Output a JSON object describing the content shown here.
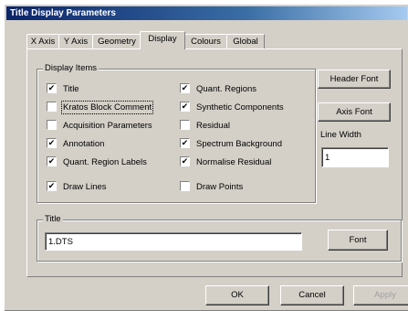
{
  "window": {
    "title": "Title Display Parameters"
  },
  "tabs": [
    {
      "label": "X Axis"
    },
    {
      "label": "Y Axis"
    },
    {
      "label": "Geometry"
    },
    {
      "label": "Display"
    },
    {
      "label": "Colours"
    },
    {
      "label": "Global"
    }
  ],
  "active_tab": "Display",
  "display_items": {
    "label": "Display Items",
    "left": [
      {
        "label": "Title",
        "checked": true
      },
      {
        "label": "Kratos Block Comment",
        "checked": false
      },
      {
        "label": "Acquisition Parameters",
        "checked": false
      },
      {
        "label": "Annotation",
        "checked": true
      },
      {
        "label": "Quant. Region Labels",
        "checked": true
      },
      {
        "label": "Draw Lines",
        "checked": true
      }
    ],
    "right": [
      {
        "label": "Quant. Regions",
        "checked": true
      },
      {
        "label": "Synthetic Components",
        "checked": true
      },
      {
        "label": "Residual",
        "checked": false
      },
      {
        "label": "Spectrum Background",
        "checked": true
      },
      {
        "label": "Normalise Residual",
        "checked": true
      },
      {
        "label": "Draw Points",
        "checked": false
      }
    ]
  },
  "side": {
    "header_font": "Header Font",
    "axis_font": "Axis Font",
    "line_width_label": "Line Width",
    "line_width_value": "1"
  },
  "title_group": {
    "label": "Title",
    "value": "1.DTS",
    "font_button": "Font"
  },
  "footer": {
    "ok": "OK",
    "cancel": "Cancel",
    "apply": "Apply"
  }
}
